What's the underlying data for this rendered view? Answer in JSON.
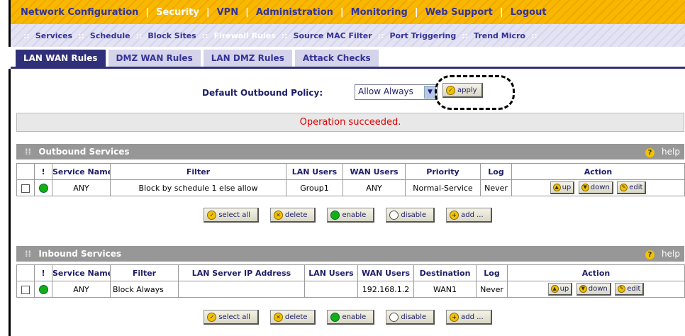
{
  "top_nav": {
    "items": [
      "Network Configuration",
      "Security",
      "VPN",
      "Administration",
      "Monitoring",
      "Web Support",
      "Logout"
    ],
    "active": "Security",
    "separator": "|"
  },
  "sub_nav": {
    "items": [
      "Services",
      "Schedule",
      "Block Sites",
      "Firewall Rules",
      "Source MAC Filter",
      "Port Triggering",
      "Trend Micro"
    ],
    "active": "Firewall Rules",
    "separator": "::"
  },
  "tabs": [
    "LAN WAN Rules",
    "DMZ WAN Rules",
    "LAN DMZ Rules",
    "Attack Checks"
  ],
  "active_tab": "LAN WAN Rules",
  "policy": {
    "label": "Default Outbound Policy:",
    "selected": "Allow Always",
    "apply_label": "apply"
  },
  "message": "Operation succeeded.",
  "outbound": {
    "title": "Outbound Services",
    "help": "help",
    "columns": [
      "",
      "!",
      "Service Name",
      "Filter",
      "LAN Users",
      "WAN Users",
      "Priority",
      "Log",
      "Action"
    ],
    "rows": [
      {
        "service": "ANY",
        "filter": "Block by schedule 1 else allow",
        "lan_users": "Group1",
        "wan_users": "ANY",
        "priority": "Normal-Service",
        "log": "Never"
      }
    ]
  },
  "inbound": {
    "title": "Inbound Services",
    "help": "help",
    "columns": [
      "",
      "!",
      "Service Name",
      "Filter",
      "LAN Server IP Address",
      "LAN Users",
      "WAN Users",
      "Destination",
      "Log",
      "Action"
    ],
    "rows": [
      {
        "service": "ANY",
        "filter": "Block Always",
        "lan_server_ip": "",
        "lan_users": "",
        "wan_users": "192.168.1.2",
        "destination": "WAN1",
        "log": "Never"
      }
    ]
  },
  "actions": {
    "up": "up",
    "down": "down",
    "edit": "edit"
  },
  "bulk_buttons": {
    "select_all": "select all",
    "delete": "delete",
    "enable": "enable",
    "disable": "disable",
    "add": "add ..."
  },
  "colors": {
    "nav_bg": "#f8b800",
    "nav_text": "#333399",
    "active_tab": "#30307a",
    "status_green": "#12b012",
    "message_red": "#dd0000"
  }
}
